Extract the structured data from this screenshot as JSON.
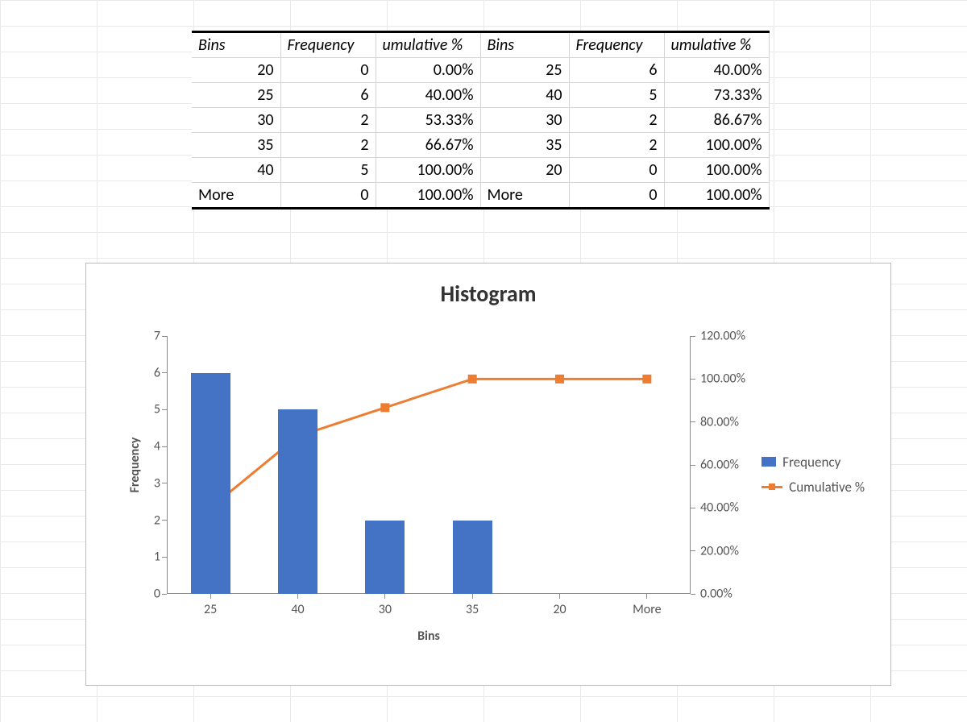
{
  "table": {
    "headers": {
      "bins1": "Bins",
      "freq1": "Frequency",
      "cum1": "umulative %",
      "bins2": "Bins",
      "freq2": "Frequency",
      "cum2": "umulative %"
    },
    "rows": [
      {
        "b1": "20",
        "f1": "0",
        "c1": "0.00%",
        "b2": "25",
        "f2": "6",
        "c2": "40.00%"
      },
      {
        "b1": "25",
        "f1": "6",
        "c1": "40.00%",
        "b2": "40",
        "f2": "5",
        "c2": "73.33%"
      },
      {
        "b1": "30",
        "f1": "2",
        "c1": "53.33%",
        "b2": "30",
        "f2": "2",
        "c2": "86.67%"
      },
      {
        "b1": "35",
        "f1": "2",
        "c1": "66.67%",
        "b2": "35",
        "f2": "2",
        "c2": "100.00%"
      },
      {
        "b1": "40",
        "f1": "5",
        "c1": "100.00%",
        "b2": "20",
        "f2": "0",
        "c2": "100.00%"
      },
      {
        "b1": "More",
        "f1": "0",
        "c1": "100.00%",
        "b2": "More",
        "f2": "0",
        "c2": "100.00%"
      }
    ]
  },
  "chart": {
    "title": "Histogram",
    "xlabel": "Bins",
    "ylabel": "Frequency",
    "legend": {
      "bar": "Frequency",
      "line": "Cumulative %"
    },
    "left_ticks": [
      "0",
      "1",
      "2",
      "3",
      "4",
      "5",
      "6",
      "7"
    ],
    "right_ticks": [
      "0.00%",
      "20.00%",
      "40.00%",
      "60.00%",
      "80.00%",
      "100.00%",
      "120.00%"
    ],
    "x_ticks": [
      "25",
      "40",
      "30",
      "35",
      "20",
      "More"
    ]
  },
  "chart_data": {
    "type": "bar",
    "title": "Histogram",
    "xlabel": "Bins",
    "ylabel": "Frequency",
    "categories": [
      "25",
      "40",
      "30",
      "35",
      "20",
      "More"
    ],
    "ylim_left": [
      0,
      7
    ],
    "ylim_right": [
      0,
      120
    ],
    "series": [
      {
        "name": "Frequency",
        "axis": "left",
        "type": "bar",
        "values": [
          6,
          5,
          2,
          2,
          0,
          0
        ]
      },
      {
        "name": "Cumulative %",
        "axis": "right",
        "type": "line",
        "values": [
          40.0,
          73.33,
          86.67,
          100.0,
          100.0,
          100.0
        ]
      }
    ]
  }
}
